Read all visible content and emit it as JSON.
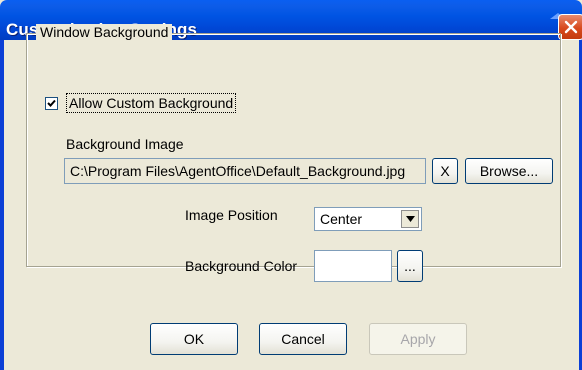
{
  "window": {
    "title": "Customization Settings",
    "close_icon": "close-icon",
    "title_bar_color": "#0054e3",
    "close_button_color": "#d84a1e"
  },
  "group": {
    "legend": "Window Background"
  },
  "custom_background": {
    "label": "Allow Custom Background",
    "checked": true
  },
  "background_image": {
    "label": "Background Image",
    "path": "C:\\Program Files\\AgentOffice\\Default_Background.jpg",
    "clear_label": "X",
    "browse_label": "Browse..."
  },
  "image_position": {
    "label": "Image Position",
    "selected": "Center"
  },
  "background_color": {
    "label": "Background Color",
    "picker_label": "...",
    "value": "#ffffff"
  },
  "buttons": {
    "ok": "OK",
    "cancel": "Cancel",
    "apply": "Apply"
  }
}
